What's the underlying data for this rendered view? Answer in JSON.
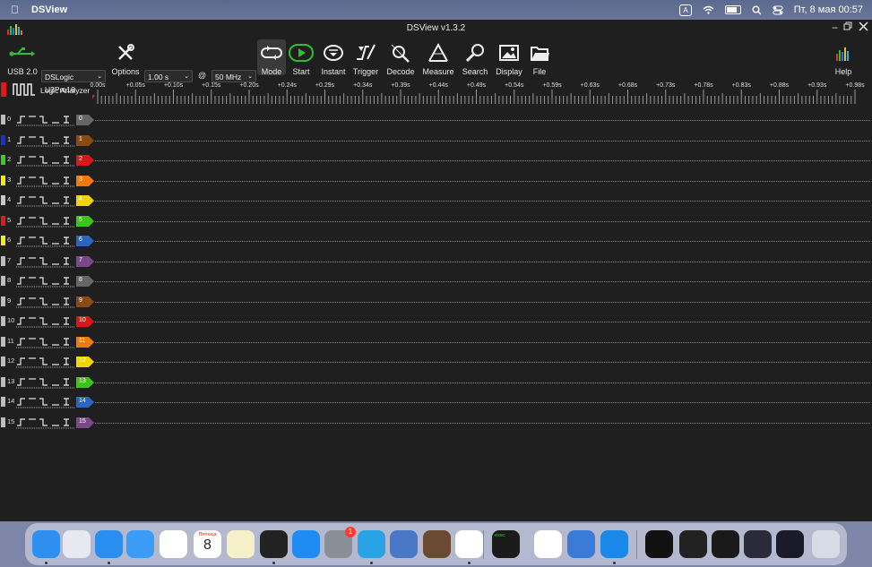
{
  "menubar": {
    "app_name": "DSView",
    "input_badge": "A",
    "clock": "Пт, 8 мая  00:57"
  },
  "window": {
    "title": "DSView v1.3.2"
  },
  "toolbar": {
    "usb_label": "USB 2.0",
    "device_select": "DSLogic U3Pro16",
    "options_label": "Options",
    "duration_select": "1.00 s",
    "at": "@",
    "rate_select": "50 MHz",
    "mode_label": "Mode",
    "start_label": "Start",
    "instant_label": "Instant",
    "trigger_label": "Trigger",
    "decode_label": "Decode",
    "measure_label": "Measure",
    "search_label": "Search",
    "display_label": "Display",
    "file_label": "File",
    "help_label": "Help"
  },
  "ruler": {
    "mode_label": "Logic Analyzer",
    "ticks": [
      "0.00s",
      "+0.05s",
      "+0.10s",
      "+0.15s",
      "+0.20s",
      "+0.24s",
      "+0.29s",
      "+0.34s",
      "+0.39s",
      "+0.44s",
      "+0.49s",
      "+0.54s",
      "+0.59s",
      "+0.63s",
      "+0.68s",
      "+0.73s",
      "+0.78s",
      "+0.83s",
      "+0.88s",
      "+0.93s",
      "+0.98s"
    ]
  },
  "channels": [
    {
      "num": "0",
      "color": "#bdbdbd",
      "tag_color": "#666666"
    },
    {
      "num": "1",
      "color": "#1530d8",
      "tag_color": "#8a4a10"
    },
    {
      "num": "2",
      "color": "#35d21c",
      "tag_color": "#d81818"
    },
    {
      "num": "3",
      "color": "#f4f000",
      "tag_color": "#f07a10"
    },
    {
      "num": "4",
      "color": "#c8c8c8",
      "tag_color": "#f2d400"
    },
    {
      "num": "5",
      "color": "#e01818",
      "tag_color": "#3cc41a"
    },
    {
      "num": "6",
      "color": "#f4f000",
      "tag_color": "#2a66c0"
    },
    {
      "num": "7",
      "color": "#bdbdbd",
      "tag_color": "#7a4a88"
    },
    {
      "num": "8",
      "color": "#bdbdbd",
      "tag_color": "#666666"
    },
    {
      "num": "9",
      "color": "#bdbdbd",
      "tag_color": "#8a4a10"
    },
    {
      "num": "10",
      "color": "#bdbdbd",
      "tag_color": "#d81818"
    },
    {
      "num": "11",
      "color": "#bdbdbd",
      "tag_color": "#f07a10"
    },
    {
      "num": "12",
      "color": "#bdbdbd",
      "tag_color": "#f2d400"
    },
    {
      "num": "13",
      "color": "#bdbdbd",
      "tag_color": "#3cc41a"
    },
    {
      "num": "14",
      "color": "#bdbdbd",
      "tag_color": "#2a66c0"
    },
    {
      "num": "15",
      "color": "#bdbdbd",
      "tag_color": "#7a4a88"
    }
  ],
  "dock": {
    "calendar_month": "Пятница",
    "calendar_day": "8",
    "settings_badge": "1",
    "terminal_text": "exec",
    "items": [
      {
        "name": "finder-icon",
        "color": "#2f8ff0"
      },
      {
        "name": "launchpad-icon",
        "color": "#e8e8f0"
      },
      {
        "name": "safari-icon",
        "color": "#2a8ef0"
      },
      {
        "name": "mail-icon",
        "color": "#3a9cf5"
      },
      {
        "name": "photos-icon",
        "color": "#ffffff"
      },
      {
        "name": "calendar-icon",
        "color": "#ffffff"
      },
      {
        "name": "notes-icon",
        "color": "#f6f0c8"
      },
      {
        "name": "terminal-icon",
        "color": "#222222"
      },
      {
        "name": "appstore-icon",
        "color": "#1e8cf2"
      },
      {
        "name": "settings-icon",
        "color": "#8a8e96"
      },
      {
        "name": "telegram-icon",
        "color": "#2aa3e6"
      },
      {
        "name": "simulator-icon",
        "color": "#4a78c8"
      },
      {
        "name": "portrait-app-icon",
        "color": "#6a4a30"
      },
      {
        "name": "vscode-icon",
        "color": "#ffffff"
      },
      {
        "name": "exec-terminal-icon",
        "color": "#1a1a1a"
      },
      {
        "name": "list-app-icon",
        "color": "#ffffff"
      },
      {
        "name": "disk-utility-icon",
        "color": "#3a7bd8"
      },
      {
        "name": "dsview-icon",
        "color": "#1a88e8"
      },
      {
        "name": "preview-window-1",
        "color": "#111111"
      },
      {
        "name": "preview-window-2",
        "color": "#222222"
      },
      {
        "name": "preview-window-3",
        "color": "#1a1a1a"
      },
      {
        "name": "preview-window-4",
        "color": "#2a2a3a"
      },
      {
        "name": "preview-window-5",
        "color": "#1a1a2a"
      },
      {
        "name": "trash-icon",
        "color": "#d8dce6"
      }
    ]
  }
}
